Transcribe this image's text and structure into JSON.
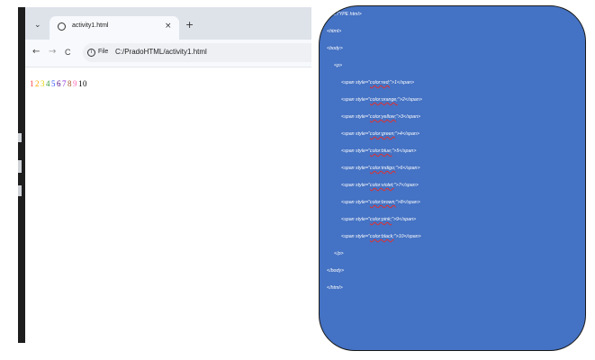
{
  "browser": {
    "tab_title": "activity1.html",
    "file_label": "File",
    "url": "C:/PradoHTML/activity1.html",
    "new_tab_glyph": "+",
    "close_glyph": "×",
    "dropdown_glyph": "⌄",
    "back_glyph": "←",
    "forward_glyph": "→",
    "reload_glyph": "C",
    "info_glyph": "i"
  },
  "page_output": {
    "numbers": [
      {
        "text": "1",
        "color": "#ff4040"
      },
      {
        "text": "2",
        "color": "#ffa500"
      },
      {
        "text": "3",
        "color": "#e6d200"
      },
      {
        "text": "4",
        "color": "#3a9a3a"
      },
      {
        "text": "5",
        "color": "#3355ff"
      },
      {
        "text": "6",
        "color": "#4b0082"
      },
      {
        "text": "7",
        "color": "#8a2be2"
      },
      {
        "text": "8",
        "color": "#a0522d"
      },
      {
        "text": "9",
        "color": "#ff69b4"
      },
      {
        "text": "10",
        "color": "#000000"
      }
    ]
  },
  "code": {
    "doctype": "<!DOCTYPE html>",
    "html_open": "<html>",
    "body_open": "<body>",
    "p_open": "<p>",
    "spans": [
      {
        "pre": "<span style=\"",
        "val": "color:red;",
        "post": "\">1</span>"
      },
      {
        "pre": "<span style=\"",
        "val": "color:orange;",
        "post": "\">2</span>"
      },
      {
        "pre": "<span style=\"",
        "val": "color:yellow;",
        "post": "\">3</span>"
      },
      {
        "pre": "<span style=\"",
        "val": "color:green;",
        "post": "\">4</span>"
      },
      {
        "pre": "<span style=\"",
        "val": "color:blue;",
        "post": "\">5</span>"
      },
      {
        "pre": "<span style=\"",
        "val": "color:indigo;",
        "post": "\">6</span>"
      },
      {
        "pre": "<span style=\"",
        "val": "color:violet;",
        "post": "\">7</span>"
      },
      {
        "pre": "<span style=\"",
        "val": "color:brown;",
        "post": "\">8</span>"
      },
      {
        "pre": "<span style=\"",
        "val": "color:pink;",
        "post": "\">9</span>"
      },
      {
        "pre": "<span style=\"",
        "val": "color:black;",
        "post": "\">10</span>"
      }
    ],
    "p_close": "</p>",
    "body_close": "</body>",
    "html_close": "</html>"
  },
  "colors": {
    "panel": "#4472c4",
    "tabbar": "#dee3ea",
    "editor_bg": "#1e1e1e"
  }
}
